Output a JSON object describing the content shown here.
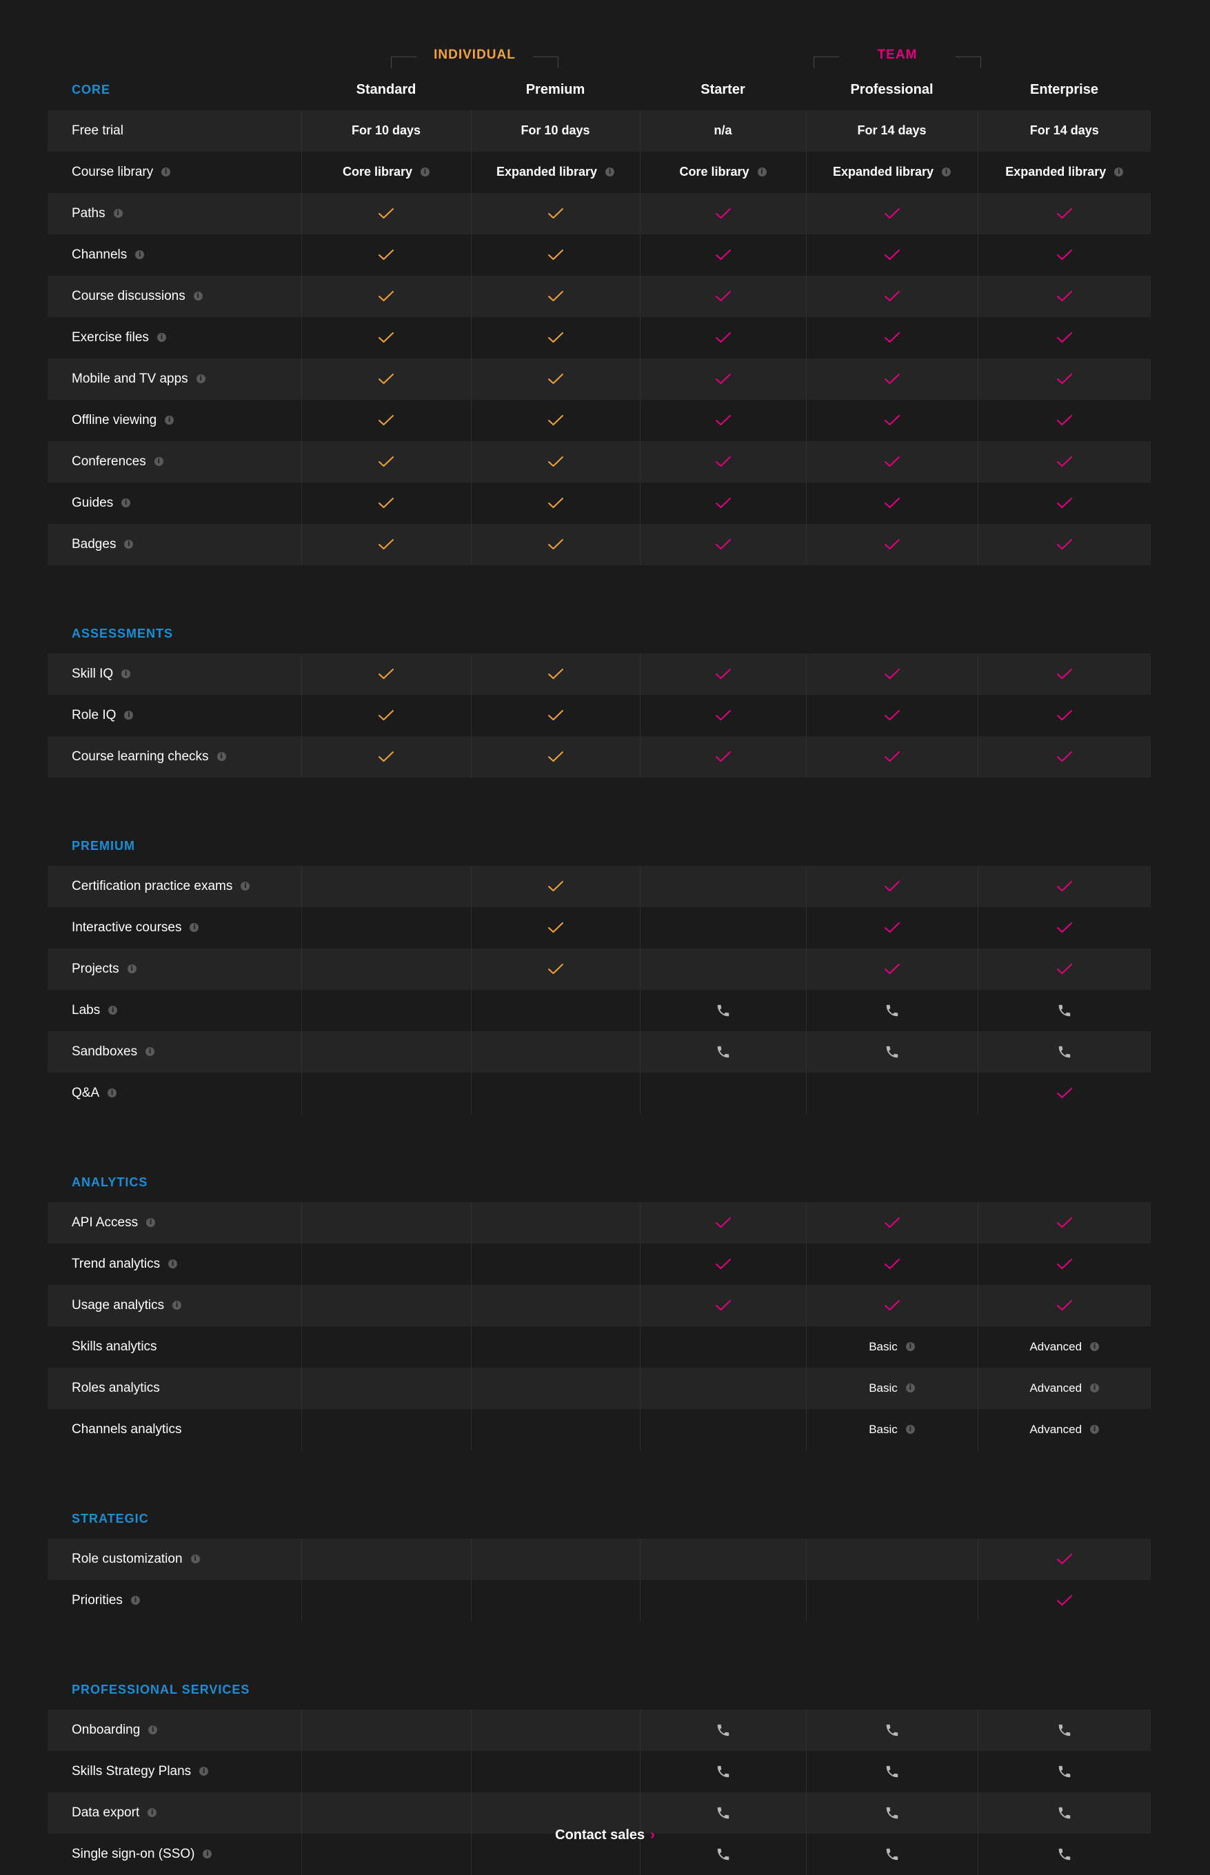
{
  "colors": {
    "individual": "#f2a33a",
    "team": "#e6007e",
    "section": "#1a8fd6"
  },
  "groups": {
    "individual": "INDIVIDUAL",
    "team": "TEAM"
  },
  "plans": [
    "Standard",
    "Premium",
    "Starter",
    "Professional",
    "Enterprise"
  ],
  "sections": [
    {
      "title": "CORE",
      "header": true,
      "rows": [
        {
          "label": "Free trial",
          "info": false,
          "cells": [
            {
              "t": "text",
              "v": "For 10 days"
            },
            {
              "t": "text",
              "v": "For 10 days"
            },
            {
              "t": "text",
              "v": "n/a"
            },
            {
              "t": "text",
              "v": "For 14 days"
            },
            {
              "t": "text",
              "v": "For 14 days"
            }
          ]
        },
        {
          "label": "Course library",
          "info": true,
          "cells": [
            {
              "t": "text",
              "v": "Core library",
              "i": true
            },
            {
              "t": "text",
              "v": "Expanded library",
              "i": true
            },
            {
              "t": "text",
              "v": "Core library",
              "i": true
            },
            {
              "t": "text",
              "v": "Expanded library",
              "i": true
            },
            {
              "t": "text",
              "v": "Expanded library",
              "i": true
            }
          ]
        },
        {
          "label": "Paths",
          "info": true,
          "cells": [
            "check",
            "check",
            "check",
            "check",
            "check"
          ]
        },
        {
          "label": "Channels",
          "info": true,
          "cells": [
            "check",
            "check",
            "check",
            "check",
            "check"
          ]
        },
        {
          "label": "Course discussions",
          "info": true,
          "cells": [
            "check",
            "check",
            "check",
            "check",
            "check"
          ]
        },
        {
          "label": "Exercise files",
          "info": true,
          "cells": [
            "check",
            "check",
            "check",
            "check",
            "check"
          ]
        },
        {
          "label": "Mobile and TV apps",
          "info": true,
          "cells": [
            "check",
            "check",
            "check",
            "check",
            "check"
          ]
        },
        {
          "label": "Offline viewing",
          "info": true,
          "cells": [
            "check",
            "check",
            "check",
            "check",
            "check"
          ]
        },
        {
          "label": "Conferences",
          "info": true,
          "cells": [
            "check",
            "check",
            "check",
            "check",
            "check"
          ]
        },
        {
          "label": "Guides",
          "info": true,
          "cells": [
            "check",
            "check",
            "check",
            "check",
            "check"
          ]
        },
        {
          "label": "Badges",
          "info": true,
          "cells": [
            "check",
            "check",
            "check",
            "check",
            "check"
          ]
        }
      ]
    },
    {
      "title": "ASSESSMENTS",
      "rows": [
        {
          "label": "Skill IQ",
          "info": true,
          "cells": [
            "check",
            "check",
            "check",
            "check",
            "check"
          ]
        },
        {
          "label": "Role IQ",
          "info": true,
          "cells": [
            "check",
            "check",
            "check",
            "check",
            "check"
          ]
        },
        {
          "label": "Course learning checks",
          "info": true,
          "cells": [
            "check",
            "check",
            "check",
            "check",
            "check"
          ]
        }
      ]
    },
    {
      "title": "PREMIUM",
      "rows": [
        {
          "label": "Certification practice exams",
          "info": true,
          "cells": [
            "",
            "check",
            "",
            "check",
            "check"
          ]
        },
        {
          "label": "Interactive courses",
          "info": true,
          "cells": [
            "",
            "check",
            "",
            "check",
            "check"
          ]
        },
        {
          "label": "Projects",
          "info": true,
          "cells": [
            "",
            "check",
            "",
            "check",
            "check"
          ]
        },
        {
          "label": "Labs",
          "info": true,
          "cells": [
            "",
            "",
            "phone",
            "phone",
            "phone"
          ]
        },
        {
          "label": "Sandboxes",
          "info": true,
          "cells": [
            "",
            "",
            "phone",
            "phone",
            "phone"
          ]
        },
        {
          "label": "Q&A",
          "info": true,
          "cells": [
            "",
            "",
            "",
            "",
            "check"
          ]
        }
      ]
    },
    {
      "title": "ANALYTICS",
      "rows": [
        {
          "label": "API Access",
          "info": true,
          "cells": [
            "",
            "",
            "check",
            "check",
            "check"
          ]
        },
        {
          "label": "Trend analytics",
          "info": true,
          "cells": [
            "",
            "",
            "check",
            "check",
            "check"
          ]
        },
        {
          "label": "Usage analytics",
          "info": true,
          "cells": [
            "",
            "",
            "check",
            "check",
            "check"
          ]
        },
        {
          "label": "Skills analytics",
          "info": false,
          "cells": [
            "",
            "",
            "",
            {
              "t": "small",
              "v": "Basic",
              "i": true
            },
            {
              "t": "small",
              "v": "Advanced",
              "i": true
            }
          ]
        },
        {
          "label": "Roles analytics",
          "info": false,
          "cells": [
            "",
            "",
            "",
            {
              "t": "small",
              "v": "Basic",
              "i": true
            },
            {
              "t": "small",
              "v": "Advanced",
              "i": true
            }
          ]
        },
        {
          "label": "Channels analytics",
          "info": false,
          "cells": [
            "",
            "",
            "",
            {
              "t": "small",
              "v": "Basic",
              "i": true
            },
            {
              "t": "small",
              "v": "Advanced",
              "i": true
            }
          ]
        }
      ]
    },
    {
      "title": "STRATEGIC",
      "rows": [
        {
          "label": "Role customization",
          "info": true,
          "cells": [
            "",
            "",
            "",
            "",
            "check"
          ]
        },
        {
          "label": "Priorities",
          "info": true,
          "cells": [
            "",
            "",
            "",
            "",
            "check"
          ]
        }
      ]
    },
    {
      "title": "PROFESSIONAL SERVICES",
      "rows": [
        {
          "label": "Onboarding",
          "info": true,
          "cells": [
            "",
            "",
            "phone",
            "phone",
            "phone"
          ]
        },
        {
          "label": "Skills Strategy Plans",
          "info": true,
          "cells": [
            "",
            "",
            "phone",
            "phone",
            "phone"
          ]
        },
        {
          "label": "Data export",
          "info": true,
          "cells": [
            "",
            "",
            "phone",
            "phone",
            "phone"
          ]
        },
        {
          "label": "Single sign-on (SSO)",
          "info": true,
          "cells": [
            "",
            "",
            "phone",
            "phone",
            "phone"
          ]
        }
      ]
    }
  ],
  "footer": {
    "cta": "Contact sales",
    "arrow": "›"
  }
}
